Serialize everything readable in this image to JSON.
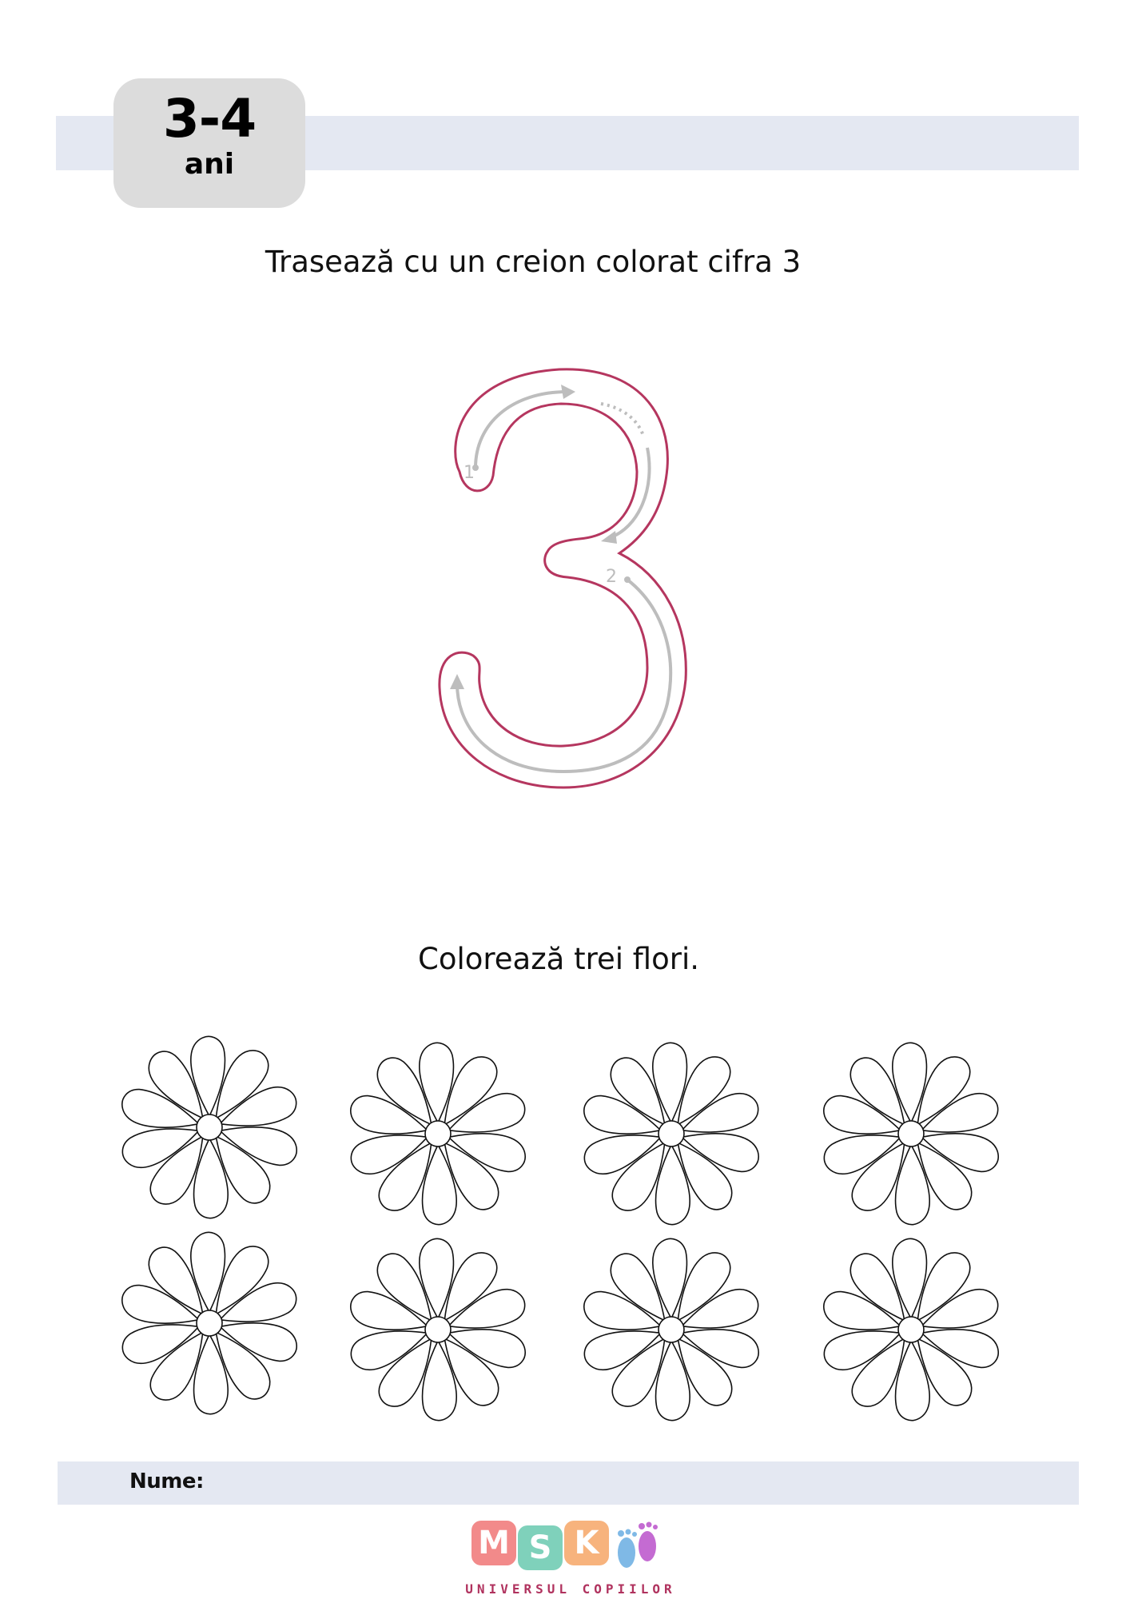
{
  "badge": {
    "number": "3-4",
    "unit": "ani"
  },
  "instructions": {
    "trace": "Trasează cu un creion colorat cifra 3",
    "color": "Colorează trei flori."
  },
  "tracing": {
    "digit": "3",
    "stroke_numbers": [
      "1",
      "2"
    ],
    "outline_color": "#b5365f",
    "guide_color": "#bdbdbd"
  },
  "flowers": {
    "count": 8,
    "rows": 2,
    "per_row": 4,
    "petals": 10
  },
  "footer": {
    "name_label": "Nume:"
  },
  "logo": {
    "letters": [
      "M",
      "S",
      "K"
    ],
    "colors": [
      "#f28a8a",
      "#7fd1bb",
      "#f7b37d"
    ],
    "tagline": "UNIVERSUL COPIILOR",
    "icon": "footprints-icon"
  }
}
